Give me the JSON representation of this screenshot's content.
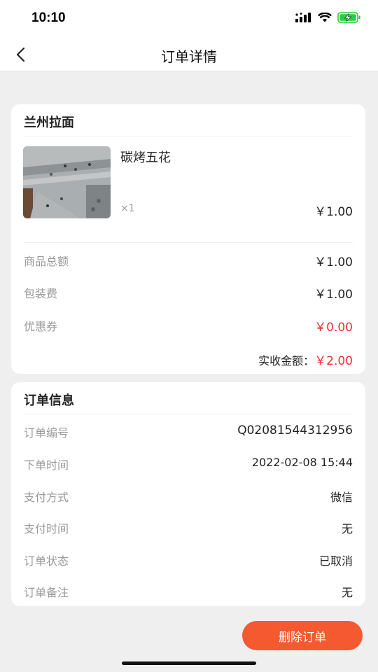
{
  "status_bar": {
    "time": "10:10"
  },
  "nav": {
    "title": "订单详情"
  },
  "order_items": {
    "store_name": "兰州拉面",
    "product": {
      "name": "碳烤五花",
      "qty": "×1",
      "price": "￥1.00"
    },
    "summary": [
      {
        "label": "商品总额",
        "value": "￥1.00",
        "highlight": false
      },
      {
        "label": "包装费",
        "value": "￥1.00",
        "highlight": false
      },
      {
        "label": "优惠券",
        "value": "￥0.00",
        "highlight": true
      }
    ],
    "total_label": "实收金额：",
    "total_value": "￥2.00"
  },
  "order_info": {
    "title": "订单信息",
    "rows": [
      {
        "label": "订单编号",
        "value": "Q02081544312956"
      },
      {
        "label": "下单时间",
        "value": "2022-02-08 15:44"
      },
      {
        "label": "支付方式",
        "value": "微信"
      },
      {
        "label": "支付时间",
        "value": "无"
      },
      {
        "label": "订单状态",
        "value": "已取消"
      },
      {
        "label": "订单备注",
        "value": "无"
      }
    ]
  },
  "actions": {
    "delete_label": "删除订单"
  },
  "colors": {
    "accent": "#f4592f",
    "price_red": "#e8312c",
    "battery_green": "#2ecc40"
  },
  "icons": {
    "back": "chevron-left-icon",
    "signal": "signal-icon",
    "wifi": "wifi-icon",
    "battery": "battery-charging-icon"
  }
}
